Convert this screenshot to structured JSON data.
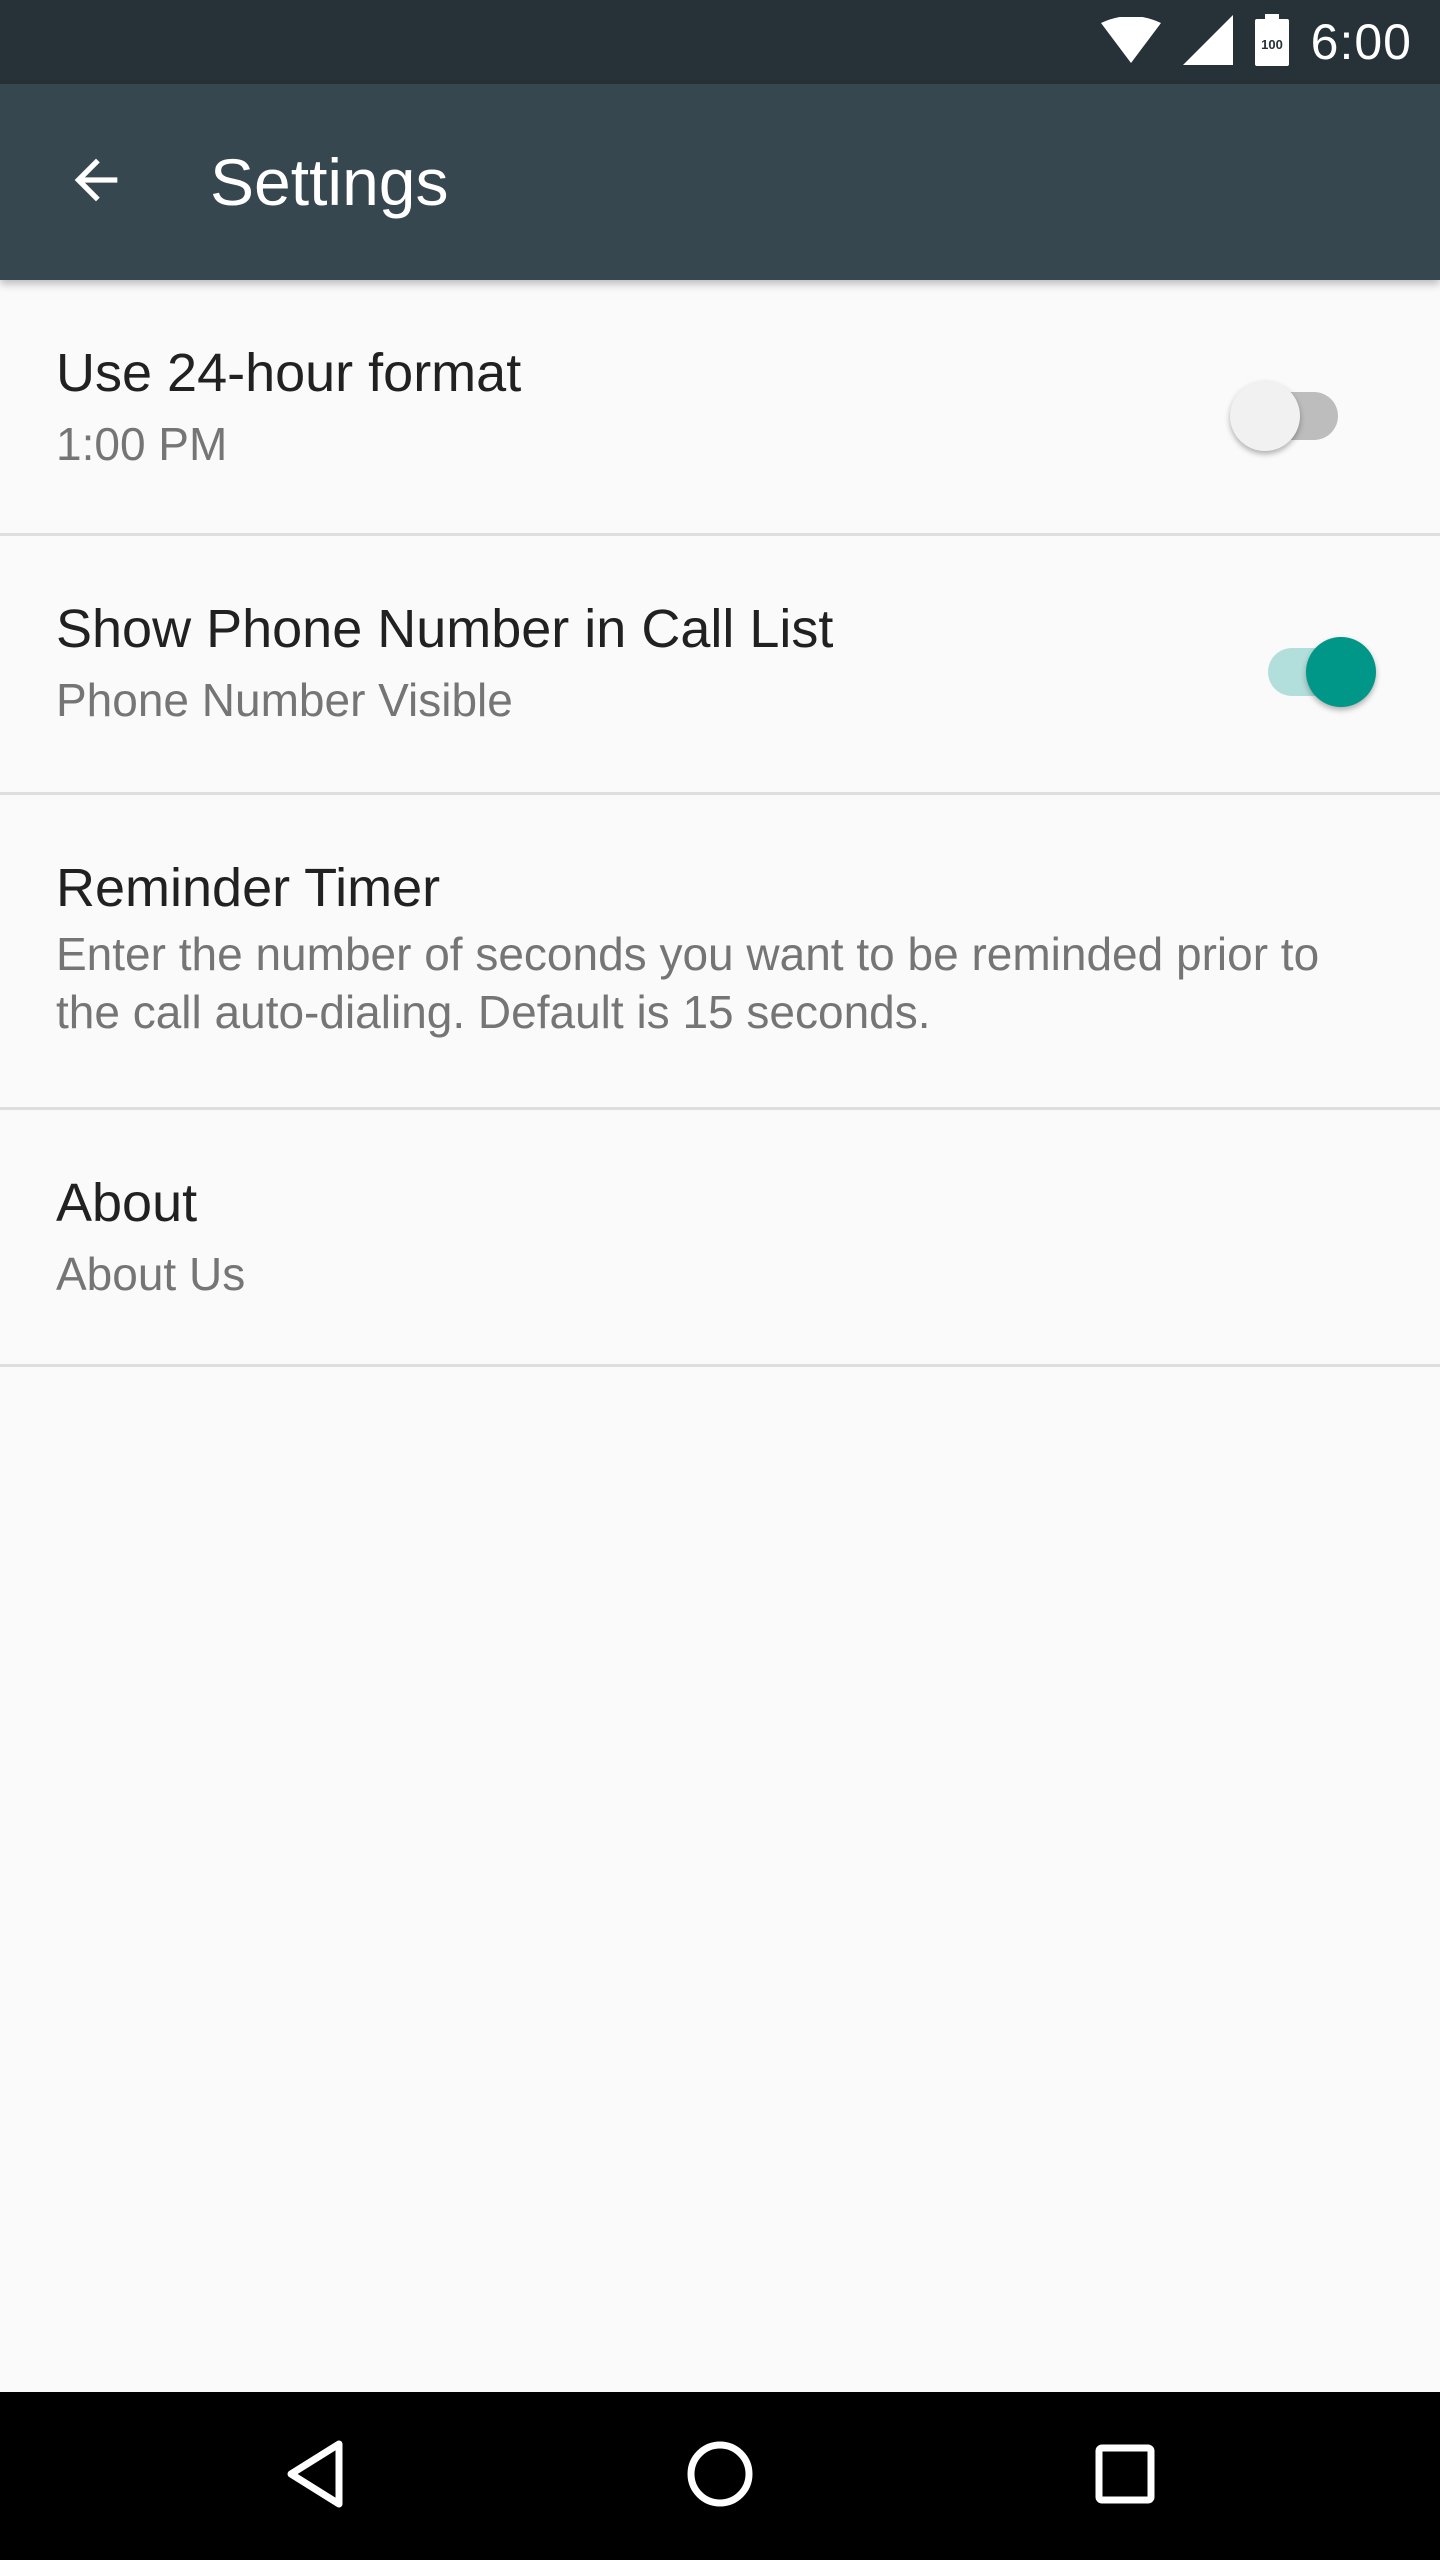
{
  "status_bar": {
    "time": "6:00",
    "battery_level": "100",
    "icons": [
      "wifi-icon",
      "cellular-signal-icon",
      "battery-icon"
    ]
  },
  "app_bar": {
    "title": "Settings",
    "back_icon": "arrow-back-icon"
  },
  "settings": [
    {
      "title": "Use 24-hour format",
      "summary": "1:00 PM",
      "switch_on": false
    },
    {
      "title": "Show Phone Number in Call List",
      "summary": "Phone Number Visible",
      "switch_on": true
    },
    {
      "title": "Reminder Timer",
      "summary": "Enter the number of seconds you want to be reminded prior to the call auto-dialing. Default is 15 seconds."
    },
    {
      "title": "About",
      "summary": "About Us"
    }
  ],
  "nav_bar": {
    "buttons": [
      "back-triangle-icon",
      "home-circle-icon",
      "recents-square-icon"
    ]
  },
  "colors": {
    "status_bar": "#263238",
    "app_bar": "#37474f",
    "accent": "#009688",
    "accent_track": "#b2dfdb",
    "background": "#fafafa",
    "divider": "#dedede"
  }
}
